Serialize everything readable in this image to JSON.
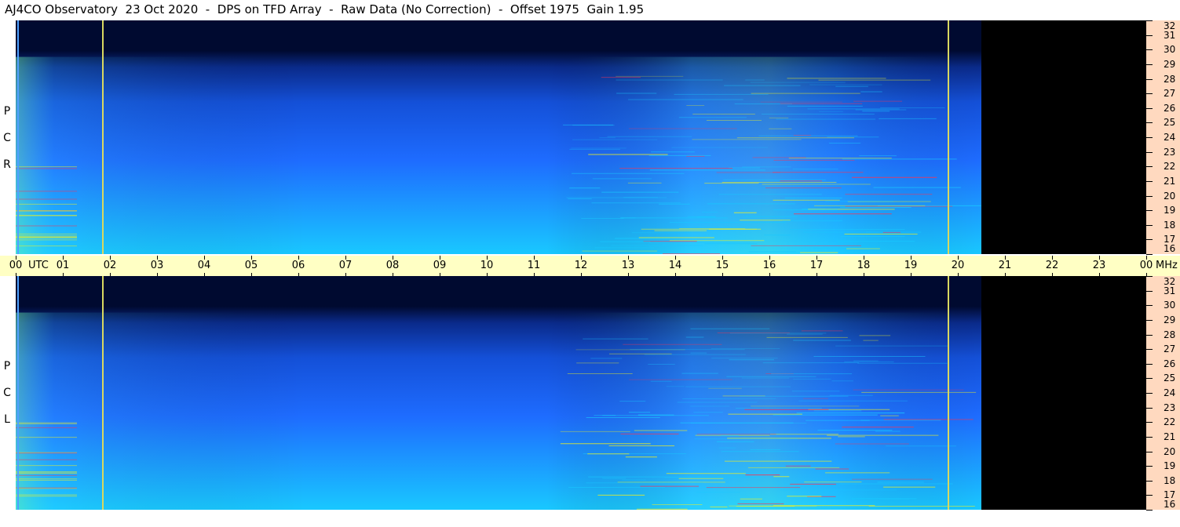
{
  "title": "AJ4CO Observatory  23 Oct 2020  -  DPS on TFD Array  -  Raw Data (No Correction)  -  Offset 1975  Gain 1.95",
  "chart_data": {
    "type": "heatmap",
    "x_unit_label": "UTC",
    "y_unit_label": "MHz",
    "x_ticks": [
      "00",
      "01",
      "02",
      "03",
      "04",
      "05",
      "06",
      "07",
      "08",
      "09",
      "10",
      "11",
      "12",
      "13",
      "14",
      "15",
      "16",
      "17",
      "18",
      "19",
      "20",
      "21",
      "22",
      "23",
      "00"
    ],
    "xlim_hours": [
      0,
      24
    ],
    "ylim_mhz": [
      16,
      32
    ],
    "y_ticks": [
      16,
      17,
      18,
      19,
      20,
      21,
      22,
      23,
      24,
      25,
      26,
      27,
      28,
      29,
      30,
      31,
      32
    ],
    "data_end_hour": 20.5,
    "markers_hours": [
      0.05,
      1.85,
      19.8
    ],
    "panels": [
      {
        "name": "R C P",
        "letters": [
          "P",
          "C",
          "R"
        ]
      },
      {
        "name": "L C P",
        "letters": [
          "P",
          "C",
          "L"
        ]
      }
    ],
    "colors": {
      "no_data": "#000000",
      "low": "#000a30",
      "mid": "#1e6cff",
      "high": "#19c8ff",
      "hot": "#f0f020",
      "rfi": "#ff3050"
    }
  }
}
